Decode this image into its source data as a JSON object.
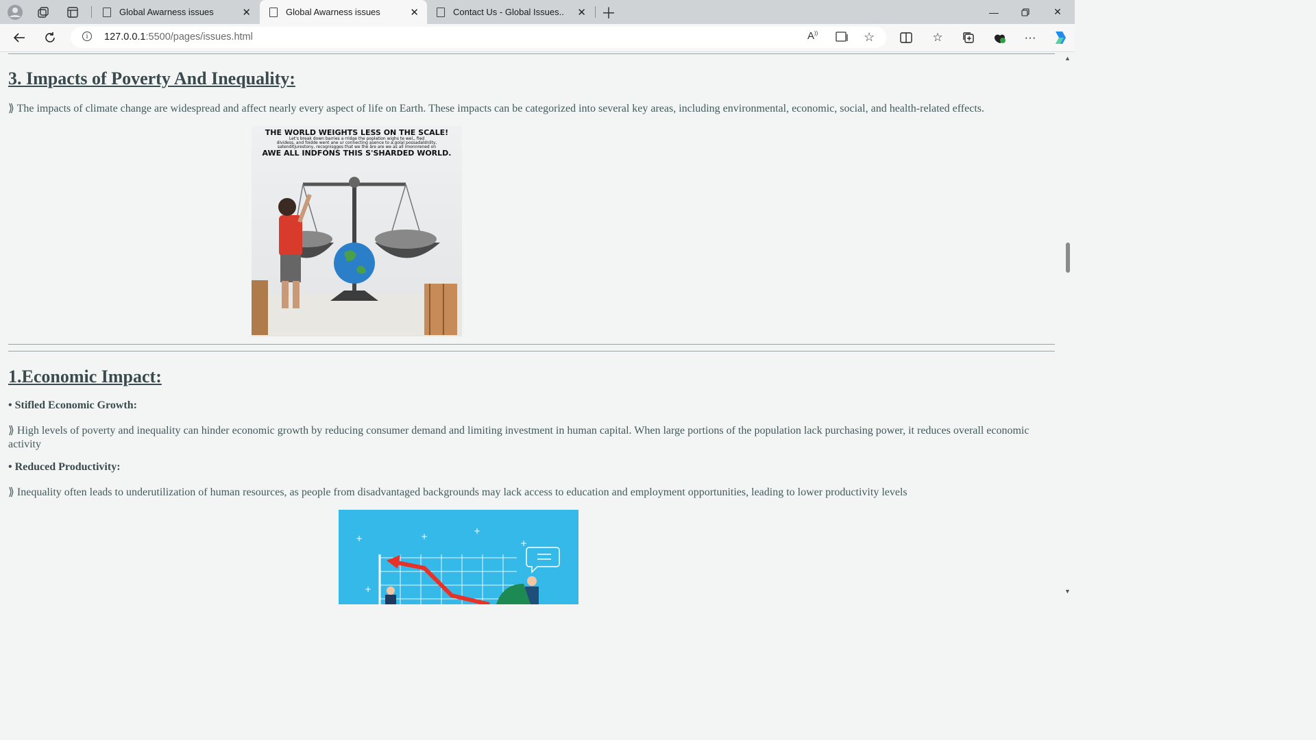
{
  "browser": {
    "tabs": [
      {
        "title": "Global Awarness issues",
        "active": false
      },
      {
        "title": "Global Awarness issues",
        "active": true
      },
      {
        "title": "Contact Us - Global Issues..",
        "active": false
      }
    ],
    "address": {
      "host": "127.0.0.1",
      "path": ":5500/pages/issues.html"
    },
    "toolbar_icons": [
      "back-icon",
      "refresh-icon",
      "info-icon",
      "read-aloud-icon",
      "immersive-reader-icon",
      "favorite-star-icon",
      "split-screen-icon",
      "favorites-icon",
      "collections-icon",
      "extensions-icon",
      "more-icon",
      "copilot-icon"
    ]
  },
  "content": {
    "section_heading": "3. Impacts of Poverty And Inequality:",
    "intro": "⟫ The impacts of climate change are widespread and affect nearly every aspect of life on Earth. These impacts can be categorized into several key areas, including environmental, economic, social, and health-related effects.",
    "poster": {
      "line1": "THE WORLD WEIGHTS LESS ON THE SCALE!",
      "line2": "Let's break down barries a rridge the poplation wighs te wel,, fied",
      "line3": "dividess, and foidde went ane ur connecting asence to a;golal possadaldnlity,",
      "line4": "satenditjurestony, recognisgges that we the âre are we as all imonnrened on",
      "line5": "AWE ALL INDFONS THIS S'SHARDED WORLD."
    },
    "sub_heading": "1.Economic Impact:",
    "points": [
      {
        "title": "• Stifled Economic Growth:",
        "text": "⟫ High levels of poverty and inequality can hinder economic growth by reducing consumer demand and limiting investment in human capital. When large portions of the population lack purchasing power, it reduces overall economic activity"
      },
      {
        "title": "• Reduced Productivity:",
        "text": "⟫ Inequality often leads to underutilization of human resources, as people from disadvantaged backgrounds may lack access to education and employment opportunities, leading to lower productivity levels"
      }
    ]
  }
}
